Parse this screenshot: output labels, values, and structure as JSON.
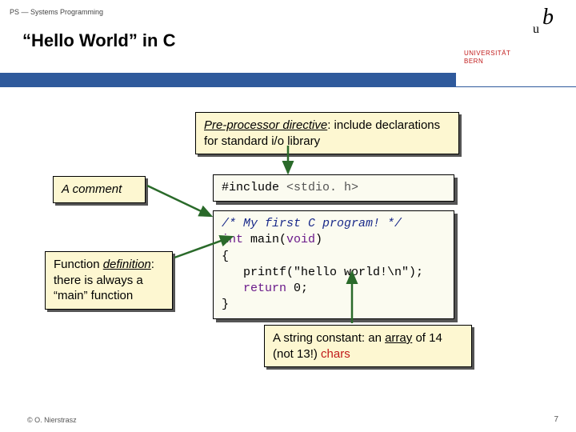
{
  "header": {
    "course_label": "PS — Systems Programming",
    "title": "“Hello World” in C"
  },
  "logo": {
    "letter_b": "b",
    "letter_u": "u",
    "line1": "UNIVERSITÄT",
    "line2": "BERN"
  },
  "callouts": {
    "preproc": {
      "prefix_underlined": "Pre-processor directive",
      "rest": ": include declarations for standard i/o library"
    },
    "comment": {
      "text": "A comment"
    },
    "funcdef": {
      "prefix": "Function ",
      "underlined": "definition",
      "rest": ": there is always a “main” function"
    },
    "stringconst": {
      "prefix": "A string constant: an ",
      "underlined": "array",
      "rest1": " of 14 (not 13!) ",
      "rest2": "chars"
    }
  },
  "code": {
    "line1_a": "#include ",
    "line1_b": "<stdio. h>",
    "line3": "/* My first C program! */",
    "line4_a": "int",
    "line4_b": " main(",
    "line4_c": "void",
    "line4_d": ")",
    "line5": "{",
    "line6": "   printf(\"hello world!\\n\");",
    "line7_a": "   ",
    "line7_b": "return",
    "line7_c": " 0;",
    "line8": "}"
  },
  "footer": {
    "copyright": "© O. Nierstrasz",
    "page": "7"
  }
}
